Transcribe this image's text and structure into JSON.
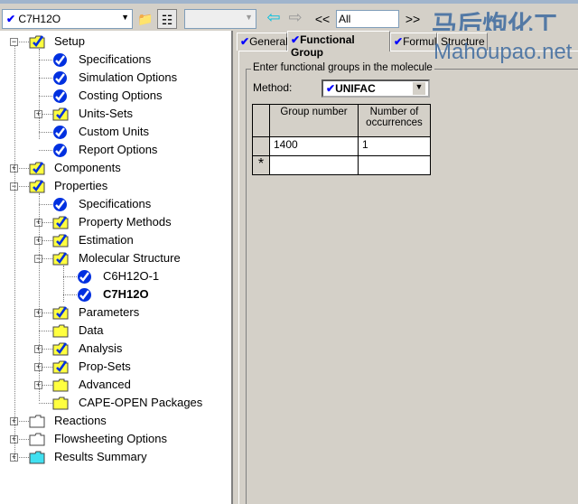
{
  "toolbar": {
    "object_select": "C7H12O",
    "blank_select": "",
    "back_label": "<<",
    "filter_select": "All",
    "forward_label": ">>"
  },
  "tree": [
    {
      "label": "Setup",
      "level": 0,
      "icon": "folder-check",
      "exp": "-"
    },
    {
      "label": "Specifications",
      "level": 1,
      "icon": "check-circle"
    },
    {
      "label": "Simulation Options",
      "level": 1,
      "icon": "check-circle"
    },
    {
      "label": "Costing Options",
      "level": 1,
      "icon": "check-circle"
    },
    {
      "label": "Units-Sets",
      "level": 1,
      "icon": "folder-check",
      "exp": "+"
    },
    {
      "label": "Custom Units",
      "level": 1,
      "icon": "check-circle"
    },
    {
      "label": "Report Options",
      "level": 1,
      "icon": "check-circle"
    },
    {
      "label": "Components",
      "level": 0,
      "icon": "folder-check",
      "exp": "+"
    },
    {
      "label": "Properties",
      "level": 0,
      "icon": "folder-check",
      "exp": "-"
    },
    {
      "label": "Specifications",
      "level": 1,
      "icon": "check-circle"
    },
    {
      "label": "Property Methods",
      "level": 1,
      "icon": "folder-check",
      "exp": "+"
    },
    {
      "label": "Estimation",
      "level": 1,
      "icon": "folder-check",
      "exp": "+"
    },
    {
      "label": "Molecular Structure",
      "level": 1,
      "icon": "folder-check",
      "exp": "-"
    },
    {
      "label": "C6H12O-1",
      "level": 2,
      "icon": "check-circle"
    },
    {
      "label": "C7H12O",
      "level": 2,
      "icon": "check-circle",
      "bold": true
    },
    {
      "label": "Parameters",
      "level": 1,
      "icon": "folder-check",
      "exp": "+"
    },
    {
      "label": "Data",
      "level": 1,
      "icon": "folder"
    },
    {
      "label": "Analysis",
      "level": 1,
      "icon": "folder-check",
      "exp": "+"
    },
    {
      "label": "Prop-Sets",
      "level": 1,
      "icon": "folder-check",
      "exp": "+"
    },
    {
      "label": "Advanced",
      "level": 1,
      "icon": "folder",
      "exp": "+"
    },
    {
      "label": "CAPE-OPEN Packages",
      "level": 1,
      "icon": "folder"
    },
    {
      "label": "Reactions",
      "level": 0,
      "icon": "folder-white",
      "exp": "+"
    },
    {
      "label": "Flowsheeting Options",
      "level": 0,
      "icon": "folder-white",
      "exp": "+"
    },
    {
      "label": "Results Summary",
      "level": 0,
      "icon": "folder-cyan",
      "exp": "+"
    }
  ],
  "tabs": [
    {
      "label": "General",
      "check": true
    },
    {
      "label": "Functional Group",
      "check": true,
      "active": true
    },
    {
      "label": "Formula",
      "check": true
    },
    {
      "label": "Structure",
      "check": false
    }
  ],
  "form": {
    "group_title": "Enter functional groups in the molecule",
    "method_label": "Method:",
    "method_value": "UNIFAC",
    "columns": [
      "Group number",
      "Number of occurrences"
    ],
    "rows": [
      [
        "1400",
        "1"
      ]
    ],
    "new_row_marker": "*"
  },
  "watermark": {
    "cn": "马后炮化工",
    "en": "Mahoupao.net"
  },
  "colors": {
    "check": "#0000ff",
    "folder": "#ffff00",
    "accent_cyan": "#00c0e0"
  }
}
